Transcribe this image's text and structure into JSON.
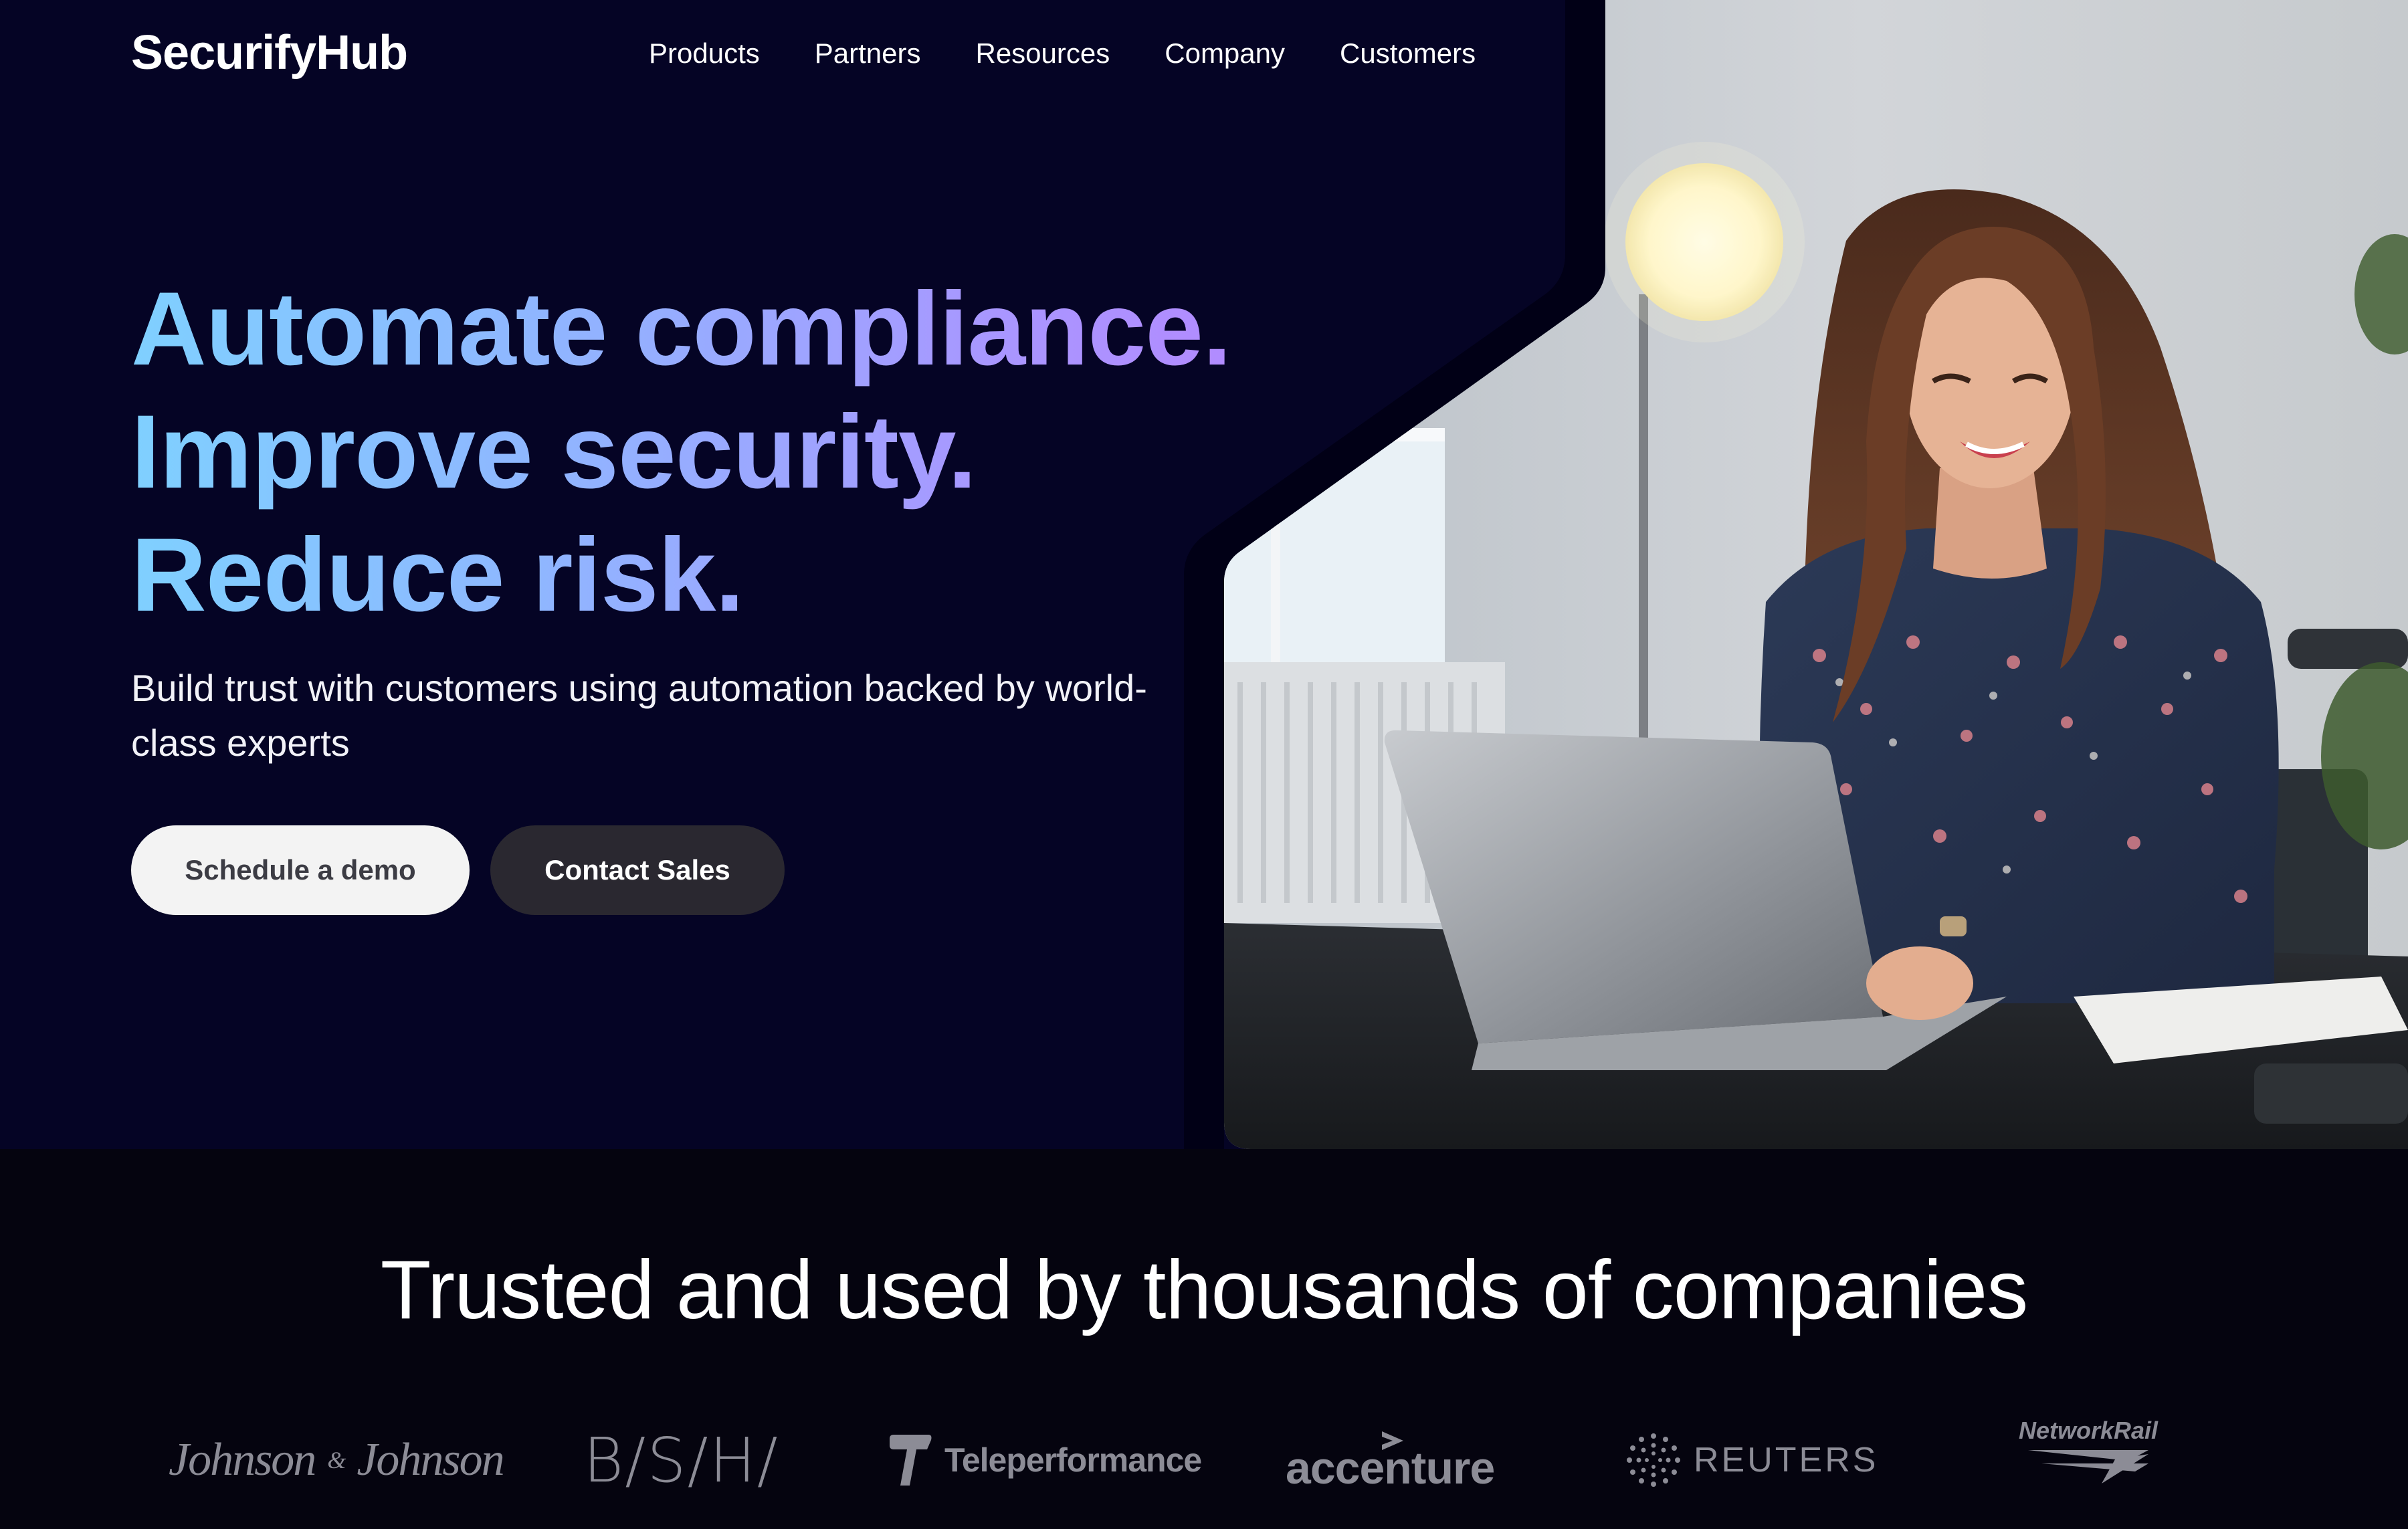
{
  "brand": {
    "name": "SecurifyHub"
  },
  "nav": {
    "items": [
      {
        "label": "Products"
      },
      {
        "label": "Partners"
      },
      {
        "label": "Resources"
      },
      {
        "label": "Company"
      },
      {
        "label": "Customers"
      }
    ]
  },
  "hero": {
    "headline_lines": [
      "Automate compliance.",
      "Improve security.",
      "Reduce risk."
    ],
    "subtitle": "Build trust with customers using automation backed by world-class experts",
    "primary_button": "Schedule a demo",
    "secondary_button": "Contact Sales",
    "image": "woman-working-on-laptop-photo"
  },
  "trusted": {
    "title": "Trusted and used by thousands of companies",
    "logos": [
      {
        "name": "Johnson & Johnson",
        "text": "Johnson",
        "amp": "&",
        "text2": "Johnson"
      },
      {
        "name": "BSH",
        "text": "B/S/H/"
      },
      {
        "name": "Teleperformance",
        "text": "Teleperformance"
      },
      {
        "name": "Accenture",
        "text": "accenture"
      },
      {
        "name": "Reuters",
        "text": "REUTERS"
      },
      {
        "name": "Network Rail",
        "text": "NetworkRail"
      }
    ]
  },
  "colors": {
    "hero_bg": "#050425",
    "page_bg": "#05040f",
    "headline_gradient_start": "#7fd0ff",
    "headline_gradient_end": "#b488ff",
    "primary_button_bg": "#f3f3f3",
    "secondary_button_bg": "#2a2830",
    "logo_gray": "#8c8c96"
  }
}
